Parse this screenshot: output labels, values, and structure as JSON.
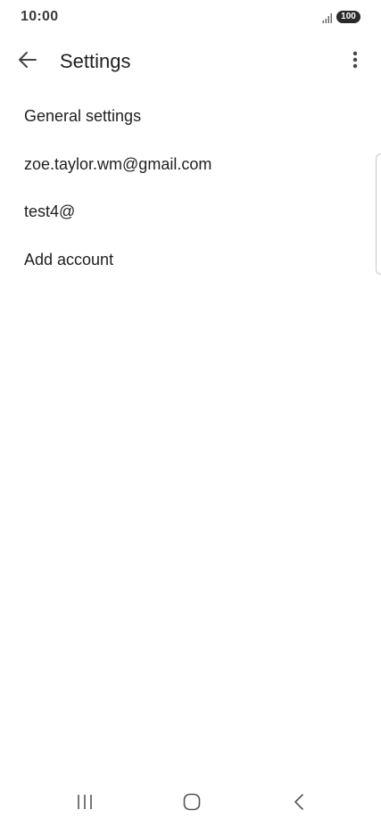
{
  "status_bar": {
    "time": "10:00",
    "battery": "100",
    "icons": [
      "signal-icon",
      "battery-icon"
    ]
  },
  "app_bar": {
    "title": "Settings",
    "icons": [
      "arrow-back-icon",
      "more-vert-icon"
    ]
  },
  "settings": {
    "items": [
      {
        "label": "General settings"
      },
      {
        "label": "zoe.taylor.wm@gmail.com"
      },
      {
        "label": "test4@"
      },
      {
        "label": "Add account"
      }
    ]
  },
  "nav_bar": {
    "icons": [
      "recents-icon",
      "home-icon",
      "nav-back-icon"
    ]
  },
  "colors": {
    "background": "#ffffff",
    "text_primary": "#1f1f1f",
    "status_text": "#3a3a3a",
    "icon": "#444444"
  }
}
